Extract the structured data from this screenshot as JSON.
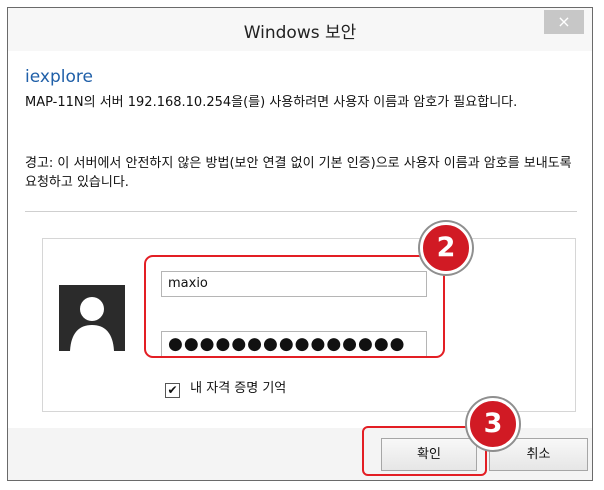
{
  "window": {
    "title": "Windows 보안",
    "close_label": "×"
  },
  "dialog": {
    "app_name": "iexplore",
    "message": "MAP-11N의 서버 192.168.10.254을(를) 사용하려면 사용자 이름과 암호가 필요합니다.",
    "warning": "경고: 이 서버에서 안전하지 않은 방법(보안 연결 없이 기본 인증)으로 사용자 이름과 암호를 보내도록 요청하고 있습니다."
  },
  "credentials": {
    "username": "maxio",
    "password_masked": "●●●●●●●●●●●●●●●",
    "remember_label": "내 자격 증명 기억",
    "remember_checked": true,
    "remember_checkmark": "✔"
  },
  "buttons": {
    "ok_label": "확인",
    "cancel_label": "취소"
  },
  "annotations": {
    "step_2": "2",
    "step_3": "3",
    "highlight_color": "#e31e24",
    "badge_color": "#d11a24"
  },
  "icons": {
    "user_avatar": "user-silhouette-icon"
  }
}
